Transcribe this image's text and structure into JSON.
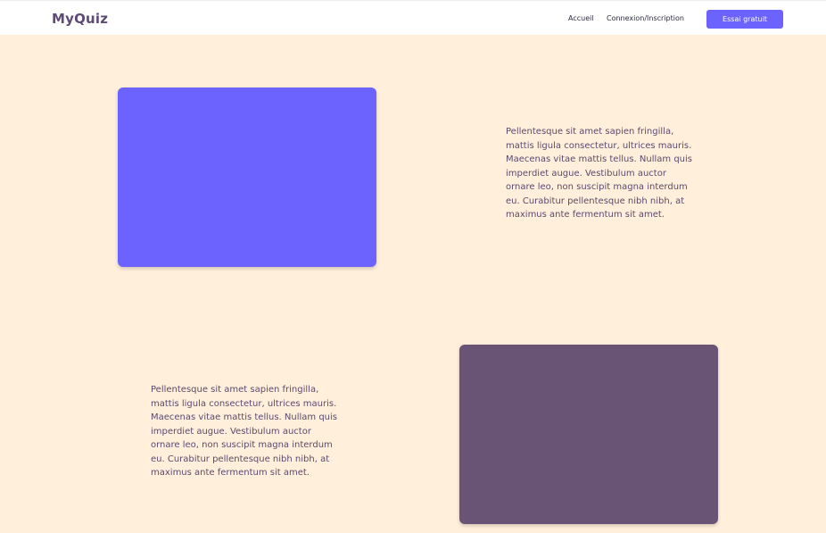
{
  "header": {
    "logo": "MyQuiz",
    "nav": {
      "home_label": "Accueil",
      "login_label": "Connexion/Inscription"
    },
    "cta_label": "Essai gratuit"
  },
  "sections": [
    {
      "text": "Pellentesque sit amet sapien fringilla, mattis ligula consectetur, ultrices mauris. Maecenas vitae mattis tellus. Nullam quis imperdiet augue. Vestibulum auctor ornare leo, non suscipit magna interdum eu. Curabitur pellentesque nibh nibh, at maximus ante fermentum sit amet.",
      "image_color": "#6C63FF"
    },
    {
      "text": "Pellentesque sit amet sapien fringilla, mattis ligula consectetur, ultrices mauris. Maecenas vitae mattis tellus. Nullam quis imperdiet augue. Vestibulum auctor ornare leo, non suscipit magna interdum eu. Curabitur pellentesque nibh nibh, at maximus ante fermentum sit amet.",
      "image_color": "#6A5475"
    }
  ],
  "colors": {
    "background": "#FFEFDB",
    "accent": "#6C63FF",
    "logo": "#5D4A75",
    "text": "#5A4A6E"
  }
}
